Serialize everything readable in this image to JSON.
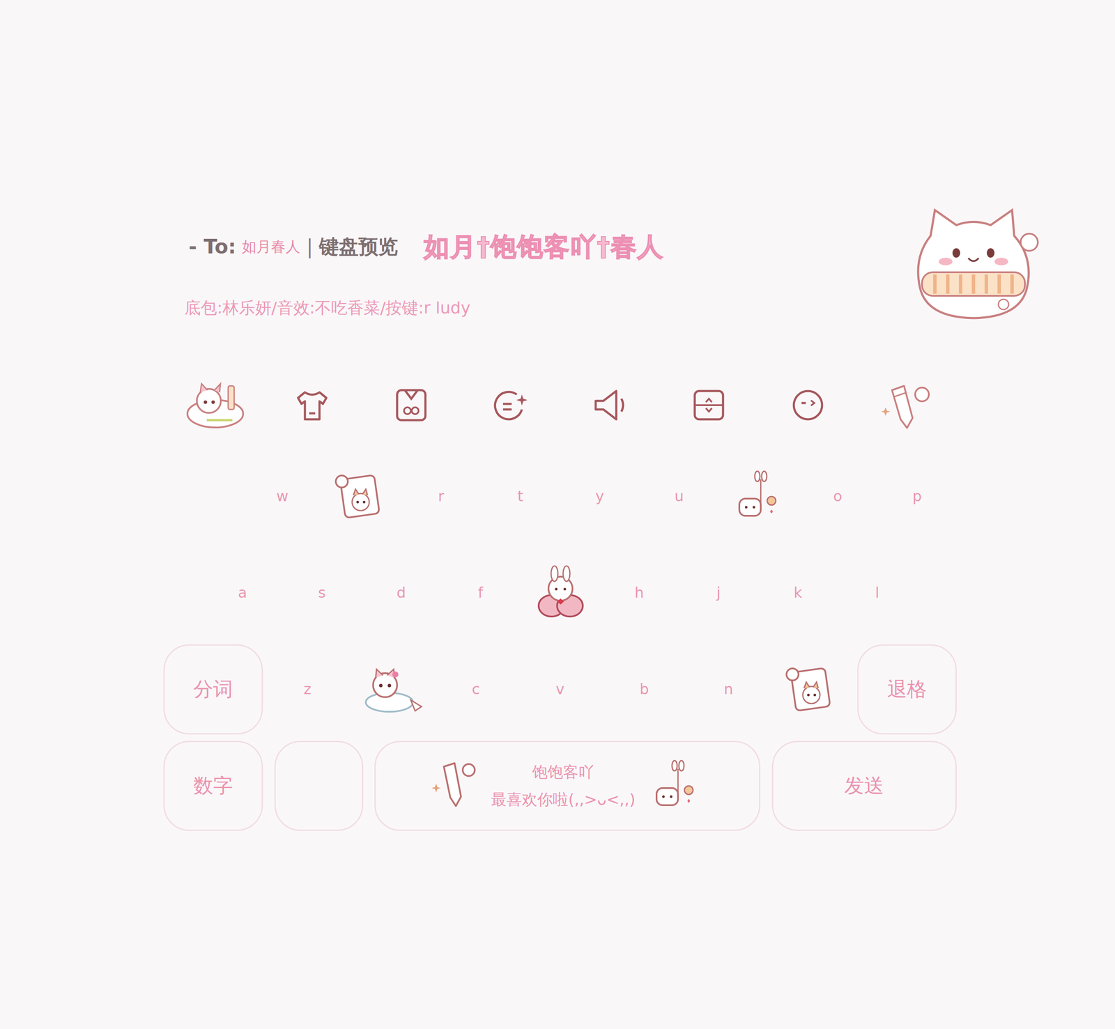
{
  "header": {
    "prefix": "- To:",
    "recipient": "如月春人",
    "separator": "|",
    "label": "键盘预览",
    "title": "如月†饱饱客吖†春人",
    "credits": "底包:林乐妍/音效:不吃香菜/按键:r ludy"
  },
  "keyboard": {
    "rows": [
      {
        "keys": [
          {
            "kind": "blank"
          },
          {
            "kind": "letter",
            "label": "w"
          },
          {
            "kind": "sticker"
          },
          {
            "kind": "letter",
            "label": "r"
          },
          {
            "kind": "letter",
            "label": "t"
          },
          {
            "kind": "letter",
            "label": "y"
          },
          {
            "kind": "letter",
            "label": "u"
          },
          {
            "kind": "sticker"
          },
          {
            "kind": "letter",
            "label": "o"
          },
          {
            "kind": "letter",
            "label": "p"
          }
        ]
      },
      {
        "keys": [
          {
            "kind": "letter",
            "label": "a"
          },
          {
            "kind": "letter",
            "label": "s"
          },
          {
            "kind": "letter",
            "label": "d"
          },
          {
            "kind": "letter",
            "label": "f"
          },
          {
            "kind": "sticker"
          },
          {
            "kind": "letter",
            "label": "h"
          },
          {
            "kind": "letter",
            "label": "j"
          },
          {
            "kind": "letter",
            "label": "k"
          },
          {
            "kind": "letter",
            "label": "l"
          }
        ]
      },
      {
        "keys": [
          {
            "kind": "function",
            "label": "分词"
          },
          {
            "kind": "letter",
            "label": "z"
          },
          {
            "kind": "sticker"
          },
          {
            "kind": "letter",
            "label": "c"
          },
          {
            "kind": "letter",
            "label": "v"
          },
          {
            "kind": "letter",
            "label": "b"
          },
          {
            "kind": "letter",
            "label": "n"
          },
          {
            "kind": "sticker"
          },
          {
            "kind": "function",
            "label": "退格"
          }
        ]
      },
      {
        "keys": [
          {
            "kind": "function",
            "label": "数字"
          },
          {
            "kind": "blank-function"
          },
          {
            "kind": "space",
            "label": "饱饱客吖",
            "sublabel": "最喜欢你啦(,,>ᴗ<,,)"
          },
          {
            "kind": "function",
            "label": "发送"
          }
        ]
      }
    ]
  }
}
